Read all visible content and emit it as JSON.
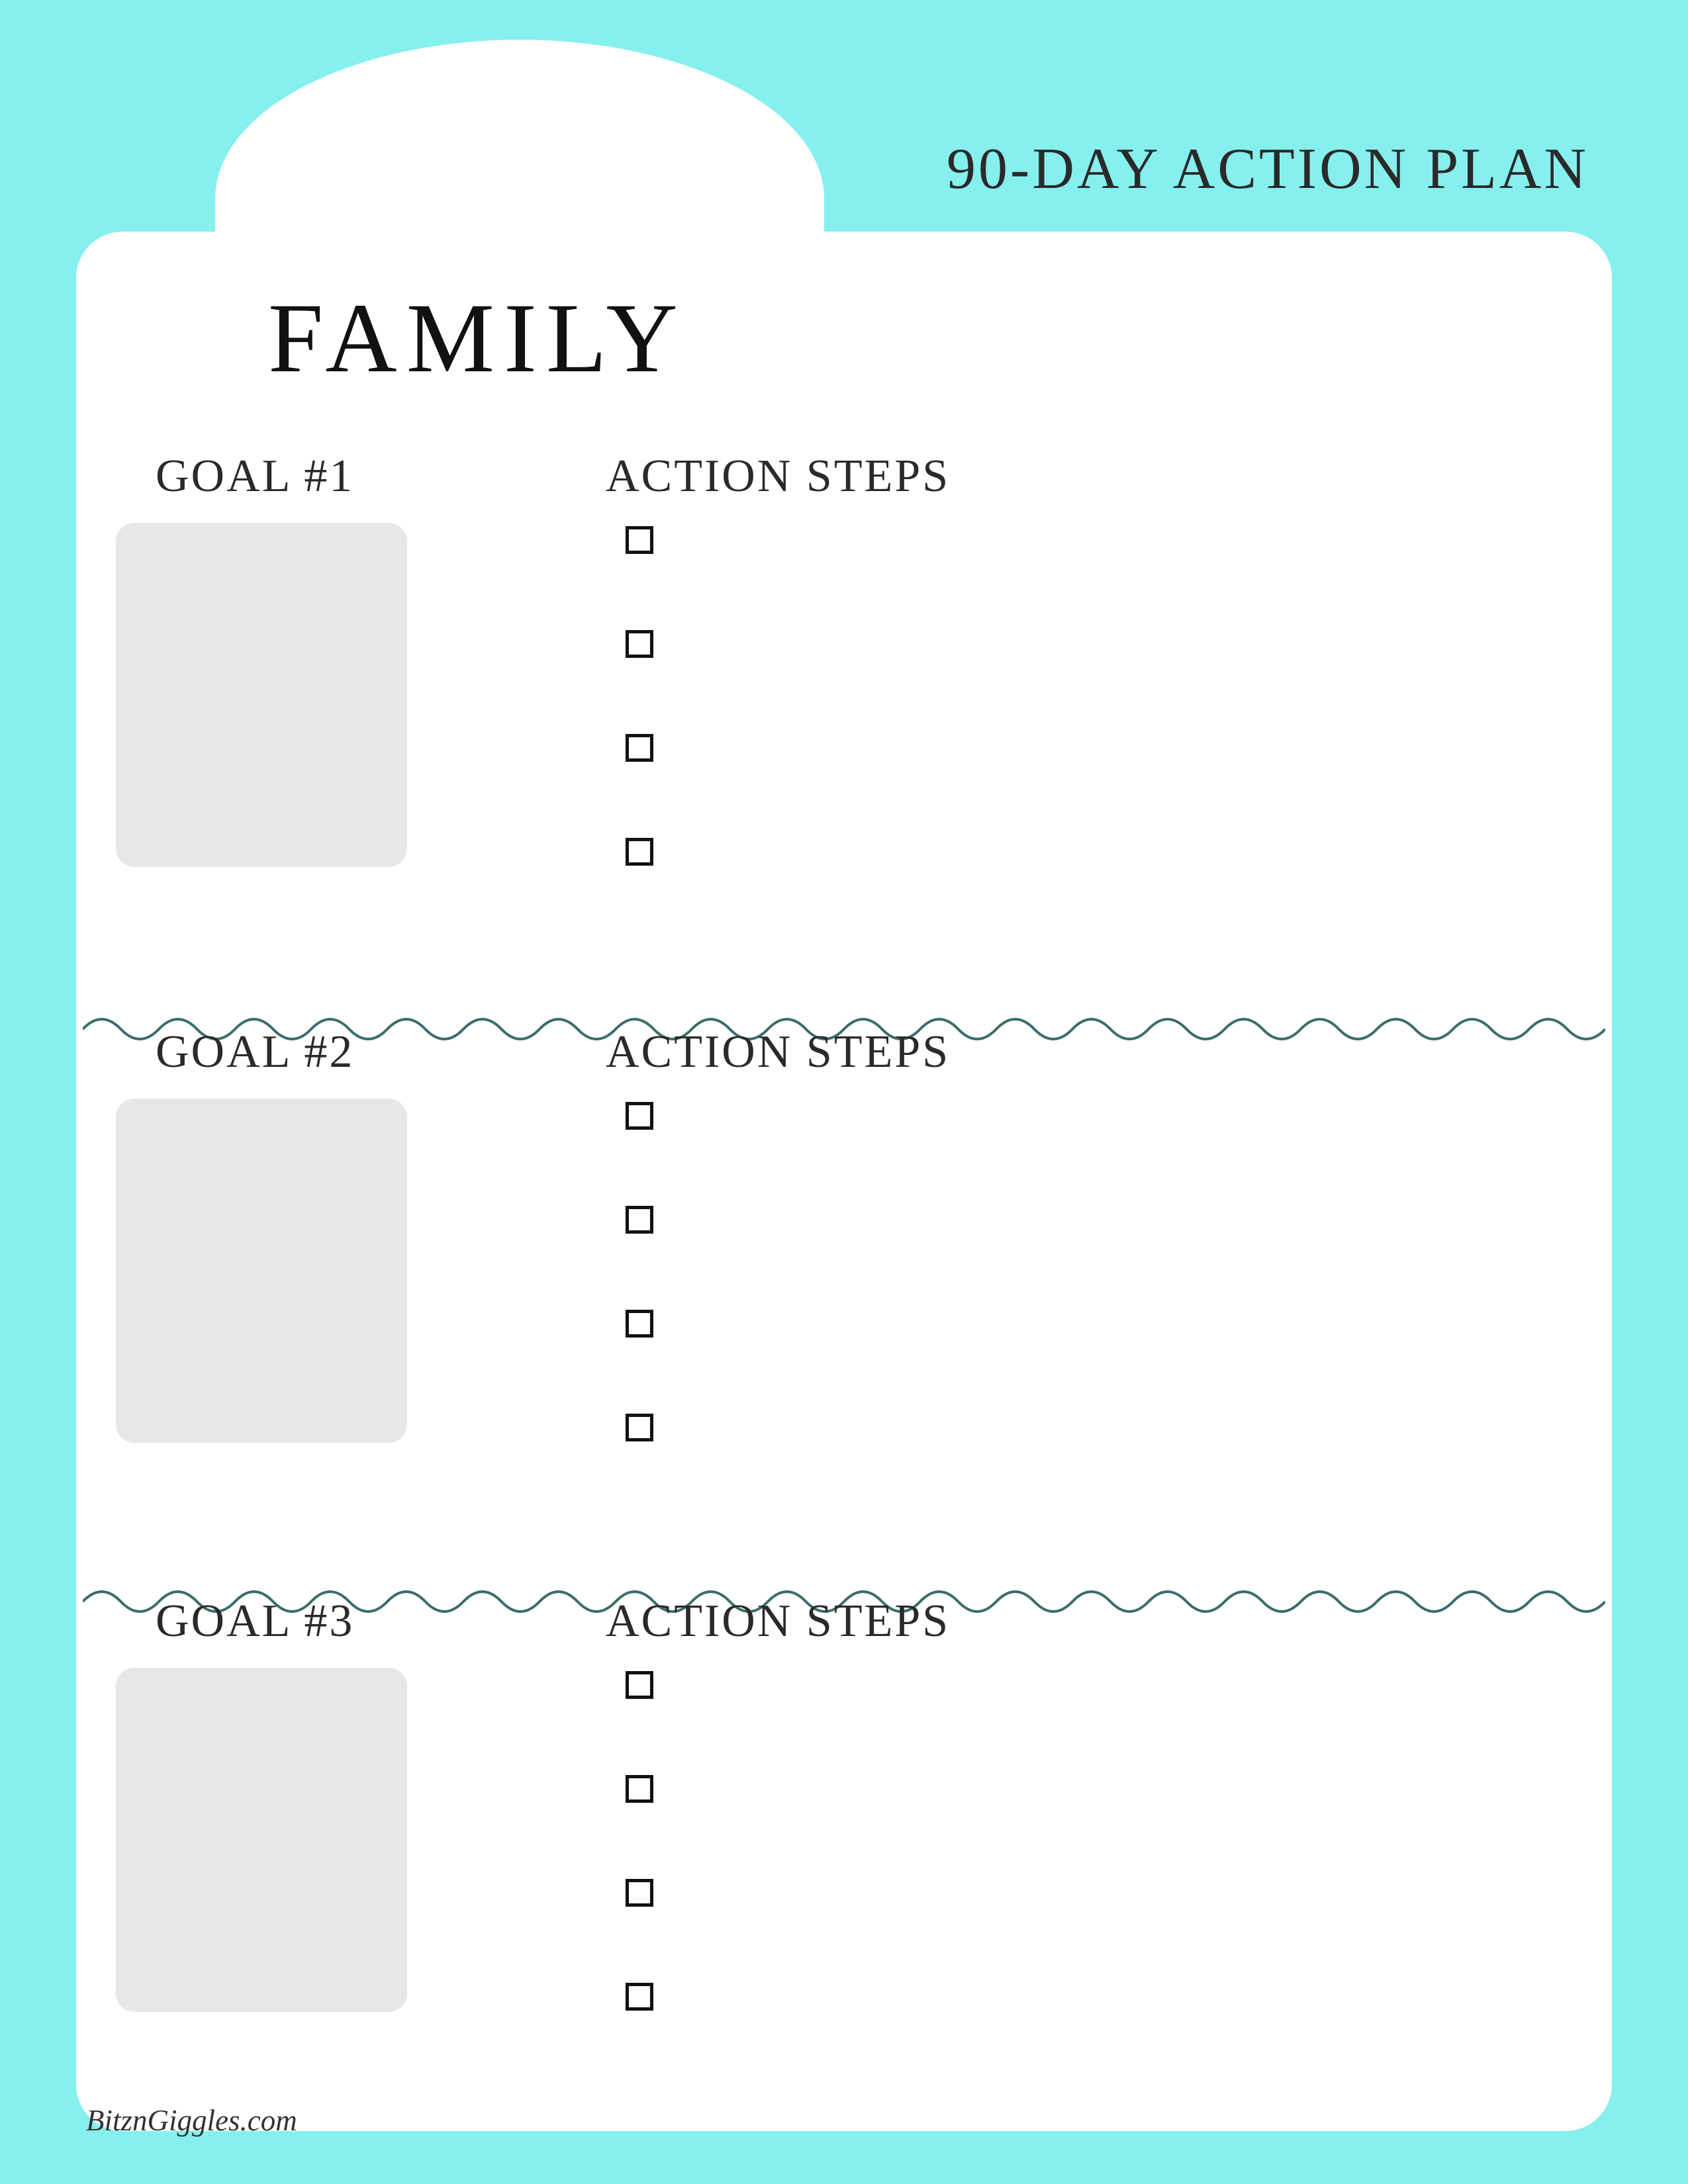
{
  "header": {
    "title": "90-DAY ACTION PLAN"
  },
  "tab": {
    "title": "FAMILY"
  },
  "sections": [
    {
      "goal_label": "GOAL #1",
      "steps_label": "ACTION STEPS",
      "steps": [
        "",
        "",
        "",
        ""
      ]
    },
    {
      "goal_label": "GOAL #2",
      "steps_label": "ACTION STEPS",
      "steps": [
        "",
        "",
        "",
        ""
      ]
    },
    {
      "goal_label": "GOAL #3",
      "steps_label": "ACTION STEPS",
      "steps": [
        "",
        "",
        "",
        ""
      ]
    }
  ],
  "footer": {
    "credit": "BitznGiggles.com"
  },
  "colors": {
    "background": "#86f0ef",
    "card": "#ffffff",
    "goal_box": "#e7e7e7",
    "wave": "#3a6d6b",
    "text": "#2a2a2a"
  }
}
